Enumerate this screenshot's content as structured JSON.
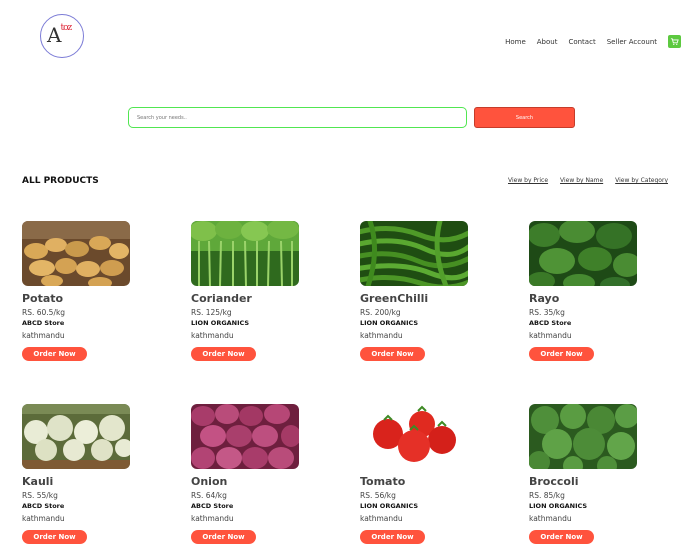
{
  "header": {
    "logo_text": "Atoz",
    "nav": [
      "Home",
      "About",
      "Contact",
      "Seller Account"
    ],
    "cart_icon": "cart-icon"
  },
  "search": {
    "placeholder": "Search your needs..",
    "button_label": "Search"
  },
  "section": {
    "title": "ALL PRODUCTS",
    "view_links": [
      "View by Price",
      "View by Name",
      "View by Category"
    ]
  },
  "products": [
    {
      "name": "Potato",
      "price": "RS. 60.5/kg",
      "store": "ABCD Store",
      "location": "kathmandu",
      "button": "Order Now"
    },
    {
      "name": "Coriander",
      "price": "RS. 125/kg",
      "store": "LION ORGANICS",
      "location": "kathmandu",
      "button": "Order Now"
    },
    {
      "name": "GreenChilli",
      "price": "RS. 200/kg",
      "store": "LION ORGANICS",
      "location": "kathmandu",
      "button": "Order Now"
    },
    {
      "name": "Rayo",
      "price": "RS. 35/kg",
      "store": "ABCD Store",
      "location": "kathmandu",
      "button": "Order Now"
    },
    {
      "name": "Kauli",
      "price": "RS. 55/kg",
      "store": "ABCD Store",
      "location": "kathmandu",
      "button": "Order Now"
    },
    {
      "name": "Onion",
      "price": "RS. 64/kg",
      "store": "ABCD Store",
      "location": "kathmandu",
      "button": "Order Now"
    },
    {
      "name": "Tomato",
      "price": "RS. 56/kg",
      "store": "LION ORGANICS",
      "location": "kathmandu",
      "button": "Order Now"
    },
    {
      "name": "Broccoli",
      "price": "RS. 85/kg",
      "store": "LION ORGANICS",
      "location": "kathmandu",
      "button": "Order Now"
    }
  ],
  "colors": {
    "accent": "#ff533d",
    "search_border": "#51e651",
    "cart": "#5dc940"
  }
}
